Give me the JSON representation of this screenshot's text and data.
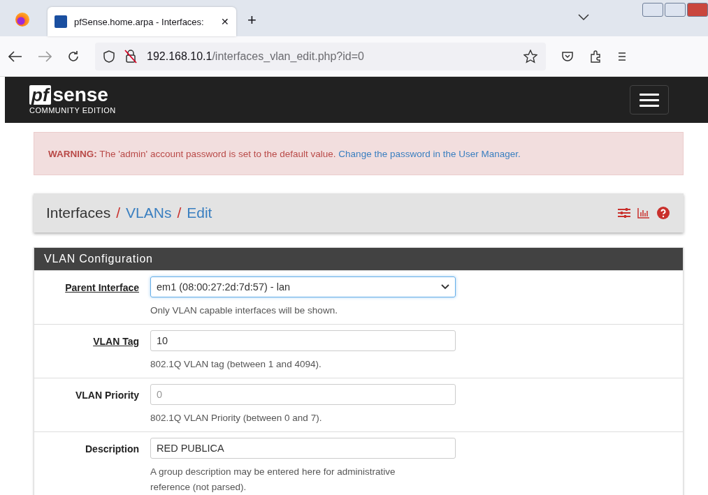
{
  "browser": {
    "tab": {
      "title": "pfSense.home.arpa - Interfaces: ",
      "close": "✕"
    },
    "new_tab": "+",
    "url": {
      "host": "192.168.10.1",
      "path": "/interfaces_vlan_edit.php?id=0"
    }
  },
  "navbar": {
    "logo": {
      "brand_left": "pf",
      "brand_right": "sense",
      "edition": "COMMUNITY EDITION"
    }
  },
  "alert": {
    "label": "WARNING:",
    "message": " The 'admin' account password is set to the default value. ",
    "link": "Change the password in the User Manager."
  },
  "breadcrumb": [
    {
      "text": "Interfaces",
      "link": false
    },
    {
      "text": "VLANs",
      "link": true
    },
    {
      "text": "Edit",
      "link": true
    }
  ],
  "breadcrumb_separator": "/",
  "panel": {
    "title": "VLAN Configuration",
    "fields": [
      {
        "label": "Parent Interface",
        "label_link": true,
        "kind": "select",
        "value": "em1 (08:00:27:2d:7d:57) - lan",
        "focused": true,
        "help": "Only VLAN capable interfaces will be shown."
      },
      {
        "label": "VLAN Tag",
        "label_link": true,
        "kind": "text",
        "value": "10",
        "focused": false,
        "help": "802.1Q VLAN tag (between 1 and 4094)."
      },
      {
        "label": "VLAN Priority",
        "label_link": false,
        "kind": "text",
        "placeholder": "0",
        "focused": false,
        "help": "802.1Q VLAN Priority (between 0 and 7)."
      },
      {
        "label": "Description",
        "label_link": false,
        "kind": "text",
        "value": "RED PUBLICA",
        "focused": false,
        "help": "A group description may be entered here for administrative reference (not parsed)."
      }
    ]
  }
}
